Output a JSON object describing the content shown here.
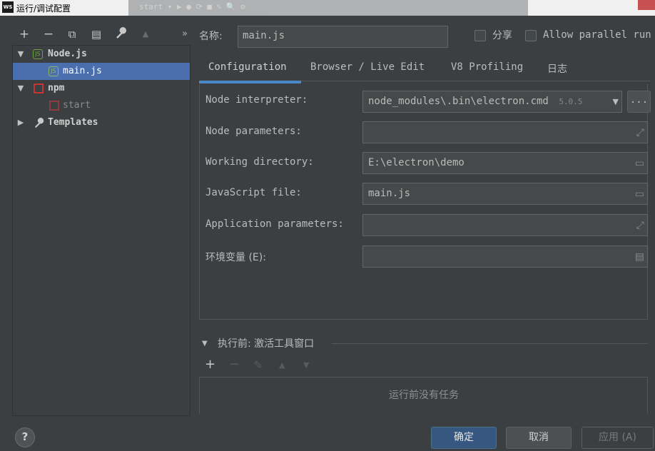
{
  "window": {
    "title": "运行/调试配置",
    "app_icon": "WS"
  },
  "background_toolbar": "start ▾   ▶  ●  ⟳  ■    ✎   🔍   ⚙",
  "toolbar": {
    "add": "+",
    "remove": "−",
    "copy": "⧉",
    "save": "▤",
    "edit_defaults": "wrench-icon",
    "move_up": "▲",
    "more": "»"
  },
  "tree": {
    "items": [
      {
        "label": "Node.js",
        "icon": "nodejs-icon",
        "bold": true
      },
      {
        "label": "main.js",
        "icon": "nodejs-icon",
        "selected": true
      },
      {
        "label": "npm",
        "icon": "npm-icon",
        "bold": true
      },
      {
        "label": "start",
        "icon": "npm-icon"
      },
      {
        "label": "Templates",
        "icon": "wrench-icon",
        "bold": true
      }
    ]
  },
  "name_label": "名称:",
  "name_value": "main.js",
  "share_label": "分享",
  "parallel_label": "Allow parallel run",
  "tabs": [
    {
      "label": "Configuration",
      "active": true
    },
    {
      "label": "Browser / Live Edit"
    },
    {
      "label": "V8 Profiling"
    },
    {
      "label": "日志"
    }
  ],
  "form": {
    "node_interpreter": {
      "label": "Node interpreter:",
      "value": "node_modules\\.bin\\electron.cmd",
      "version": "5.0.5",
      "browse": "..."
    },
    "node_parameters": {
      "label": "Node parameters:",
      "value": ""
    },
    "working_directory": {
      "label": "Working directory:",
      "value": "E:\\electron\\demo"
    },
    "javascript_file": {
      "label": "JavaScript file:",
      "value": "main.js"
    },
    "application_parameters": {
      "label": "Application parameters:",
      "value": ""
    },
    "env_vars": {
      "label": "环境变量 (E):",
      "value": ""
    }
  },
  "before_launch": {
    "title": "执行前: 激活工具窗口",
    "empty_text": "运行前没有任务",
    "toolbar": {
      "add": "+",
      "remove": "−",
      "edit": "✎",
      "up": "▲",
      "down": "▼"
    }
  },
  "footer": {
    "help": "?",
    "ok": "确定",
    "cancel": "取消",
    "apply": "应用 (A)"
  },
  "colors": {
    "accent": "#4b6eaf",
    "primary_button": "#365880",
    "background": "#3c3f41",
    "field": "#45494a"
  }
}
